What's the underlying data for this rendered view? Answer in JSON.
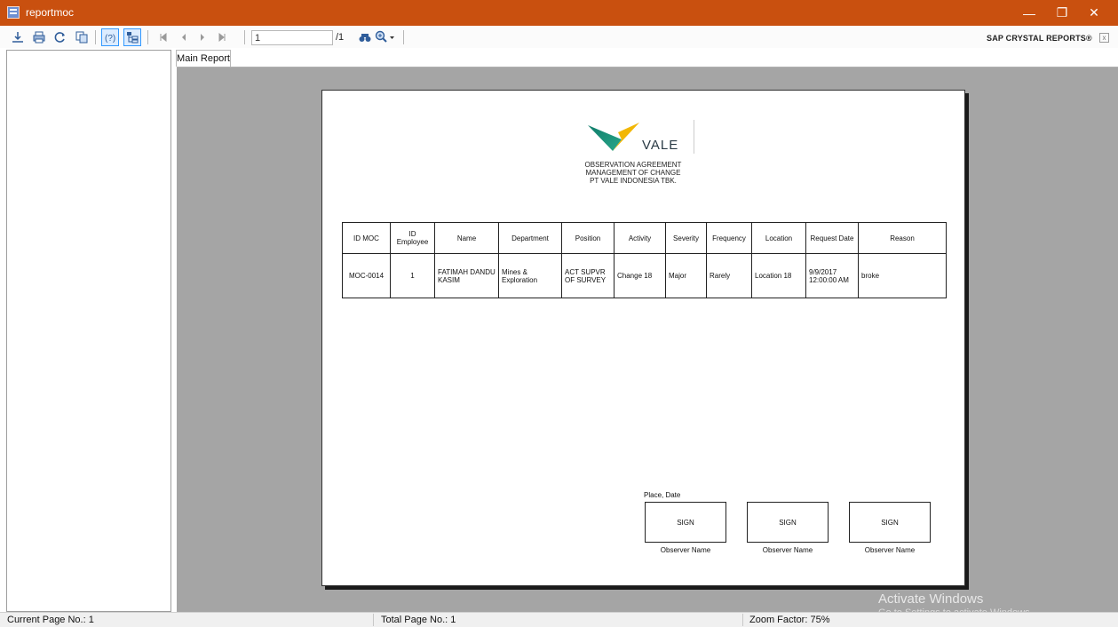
{
  "window": {
    "title": "reportmoc",
    "minimize_label": "—",
    "restore_label": "❐",
    "close_label": "✕"
  },
  "toolbar": {
    "page_input": "1",
    "page_total": "/1",
    "brand": "SAP CRYSTAL REPORTS®",
    "brand_close": "x",
    "icons": [
      "export-icon",
      "print-icon",
      "refresh-icon",
      "copy-icon",
      "help-icon",
      "group-tree-icon",
      "first-page-icon",
      "prev-page-icon",
      "next-page-icon",
      "last-page-icon",
      "find-icon",
      "zoom-icon"
    ]
  },
  "tabs": [
    {
      "label": "Main Report"
    }
  ],
  "report": {
    "logo_text": "VALE",
    "heading_lines": [
      "OBSERVATION AGREEMENT",
      "MANAGEMENT OF CHANGE",
      "PT VALE INDONESIA TBK."
    ],
    "columns": {
      "id_moc": "ID MOC",
      "id_employee": "ID Employee",
      "name": "Name",
      "department": "Department",
      "position": "Position",
      "activity": "Activity",
      "severity": "Severity",
      "frequency": "Frequency",
      "location": "Location",
      "request_date": "Request Date",
      "reason": "Reason"
    },
    "rows": [
      {
        "id_moc": "MOC-0014",
        "id_employee": "1",
        "name": "FATIMAH DANDU KASIM",
        "department": "Mines & Exploration",
        "position": "ACT SUPVR OF SURVEY",
        "activity": "Change 18",
        "severity": "Major",
        "frequency": "Rarely",
        "location": "Location 18",
        "request_date": "9/9/2017 12:00:00 AM",
        "reason": "broke"
      }
    ],
    "place_date": "Place, Date",
    "signatures": [
      {
        "sign": "SIGN",
        "observer": "Observer Name"
      },
      {
        "sign": "SIGN",
        "observer": "Observer Name"
      },
      {
        "sign": "SIGN",
        "observer": "Observer Name"
      }
    ]
  },
  "watermark": "Activate Windows",
  "watermark_sub": "Go to Settings to activate Windows.",
  "status": {
    "current_page": "Current Page No.: 1",
    "total_page": "Total Page No.: 1",
    "zoom": "Zoom Factor: 75%"
  },
  "colors": {
    "titlebar": "#c9500f",
    "viewer_bg": "#a5a5a5",
    "logo_green": "#1e8a6a",
    "logo_yellow": "#f2b705"
  }
}
